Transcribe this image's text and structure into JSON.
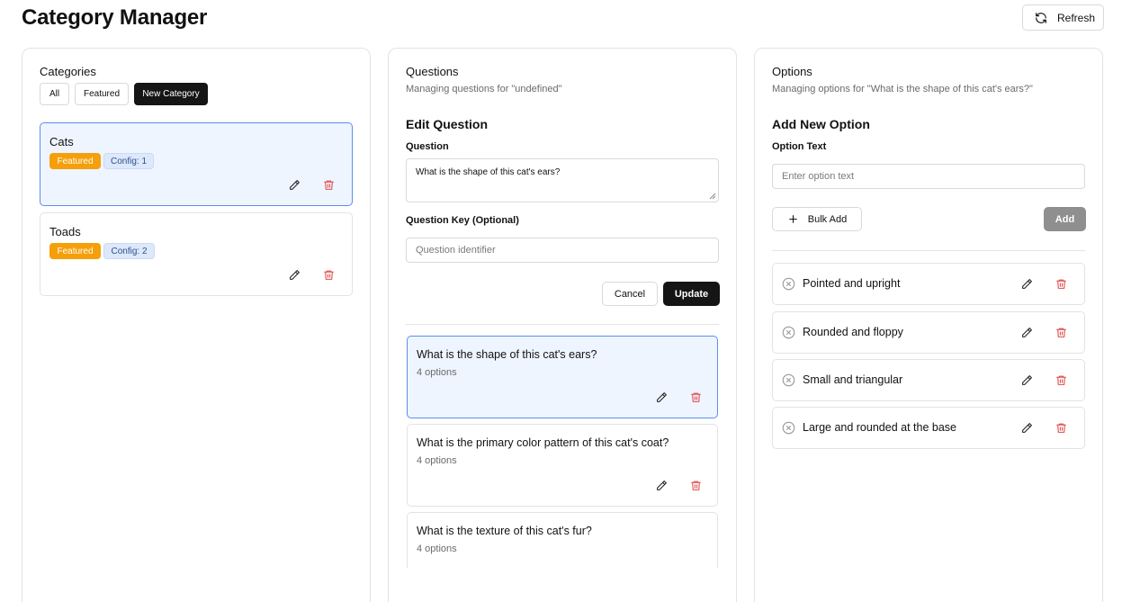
{
  "header": {
    "title": "Category Manager",
    "refresh_label": "Refresh"
  },
  "categories_panel": {
    "title": "Categories",
    "filters": {
      "all": "All",
      "featured": "Featured"
    },
    "new_label": "New Category",
    "items": [
      {
        "name": "Cats",
        "badge": "Featured",
        "config": "Config: 1",
        "selected": true
      },
      {
        "name": "Toads",
        "badge": "Featured",
        "config": "Config: 2",
        "selected": false
      }
    ]
  },
  "questions_panel": {
    "title": "Questions",
    "subtitle": "Managing questions for \"undefined\"",
    "edit_title": "Edit Question",
    "question_label": "Question",
    "question_value": "What is the shape of this cat's ears?",
    "key_label": "Question Key (Optional)",
    "key_placeholder": "Question identifier",
    "cancel_label": "Cancel",
    "update_label": "Update",
    "items": [
      {
        "text": "What is the shape of this cat's ears?",
        "count": "4 options",
        "selected": true
      },
      {
        "text": "What is the primary color pattern of this cat's coat?",
        "count": "4 options",
        "selected": false
      },
      {
        "text": "What is the texture of this cat's fur?",
        "count": "4 options",
        "selected": false
      }
    ]
  },
  "options_panel": {
    "title": "Options",
    "subtitle": "Managing options for \"What is the shape of this cat's ears?\"",
    "add_title": "Add New Option",
    "option_label": "Option Text",
    "option_placeholder": "Enter option text",
    "bulk_label": "Bulk Add",
    "add_label": "Add",
    "items": [
      {
        "text": "Pointed and upright"
      },
      {
        "text": "Rounded and floppy"
      },
      {
        "text": "Small and triangular"
      },
      {
        "text": "Large and rounded at the base"
      }
    ]
  },
  "colors": {
    "featured_badge": "#f59f0b",
    "selected_border": "#5a8ee8",
    "selected_bg": "#eef5ff",
    "delete_icon": "#e24a4a",
    "primary_button": "#151515"
  },
  "icons": [
    "refresh-icon",
    "pencil-icon",
    "trash-icon",
    "plus-icon",
    "circle-x-icon"
  ]
}
